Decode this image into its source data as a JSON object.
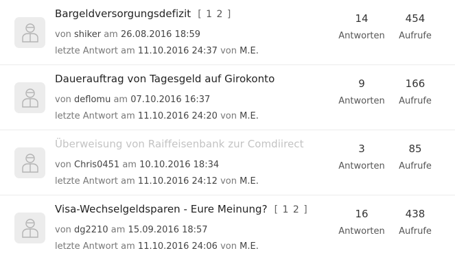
{
  "threads": [
    {
      "title": "Bargeldversorgungsdefizit",
      "visited": false,
      "pages": [
        "1",
        "2"
      ],
      "by_prefix": "von",
      "author": "shiker",
      "at_prefix": "am",
      "created": "26.08.2016 18:59",
      "last_prefix": "letzte Antwort am",
      "last_date": "11.10.2016 24:37",
      "last_by_prefix": "von",
      "last_user": "M.E.",
      "answers": "14",
      "answers_label": "Antworten",
      "views": "454",
      "views_label": "Aufrufe"
    },
    {
      "title": "Dauerauftrag von Tagesgeld auf Girokonto",
      "visited": false,
      "pages": [],
      "by_prefix": "von",
      "author": "deflomu",
      "at_prefix": "am",
      "created": "07.10.2016 16:37",
      "last_prefix": "letzte Antwort am",
      "last_date": "11.10.2016 24:20",
      "last_by_prefix": "von",
      "last_user": "M.E.",
      "answers": "9",
      "answers_label": "Antworten",
      "views": "166",
      "views_label": "Aufrufe"
    },
    {
      "title": "Überweisung von Raiffeisenbank zur Comdiirect",
      "visited": true,
      "pages": [],
      "by_prefix": "von",
      "author": "Chris0451",
      "at_prefix": "am",
      "created": "10.10.2016 18:34",
      "last_prefix": "letzte Antwort am",
      "last_date": "11.10.2016 24:12",
      "last_by_prefix": "von",
      "last_user": "M.E.",
      "answers": "3",
      "answers_label": "Antworten",
      "views": "85",
      "views_label": "Aufrufe"
    },
    {
      "title": "Visa-Wechselgeldsparen - Eure Meinung?",
      "visited": false,
      "pages": [
        "1",
        "2"
      ],
      "by_prefix": "von",
      "author": "dg2210",
      "at_prefix": "am",
      "created": "15.09.2016 18:57",
      "last_prefix": "letzte Antwort am",
      "last_date": "11.10.2016 24:06",
      "last_by_prefix": "von",
      "last_user": "M.E.",
      "answers": "16",
      "answers_label": "Antworten",
      "views": "438",
      "views_label": "Aufrufe"
    }
  ],
  "page_bracket_open": "[",
  "page_bracket_close": "]",
  "avatar_icon": "user-placeholder-icon",
  "colors": {
    "title": "#222222",
    "visited_title": "#c3c3c3",
    "meta": "#777777",
    "avatar_bg": "#ececec"
  }
}
